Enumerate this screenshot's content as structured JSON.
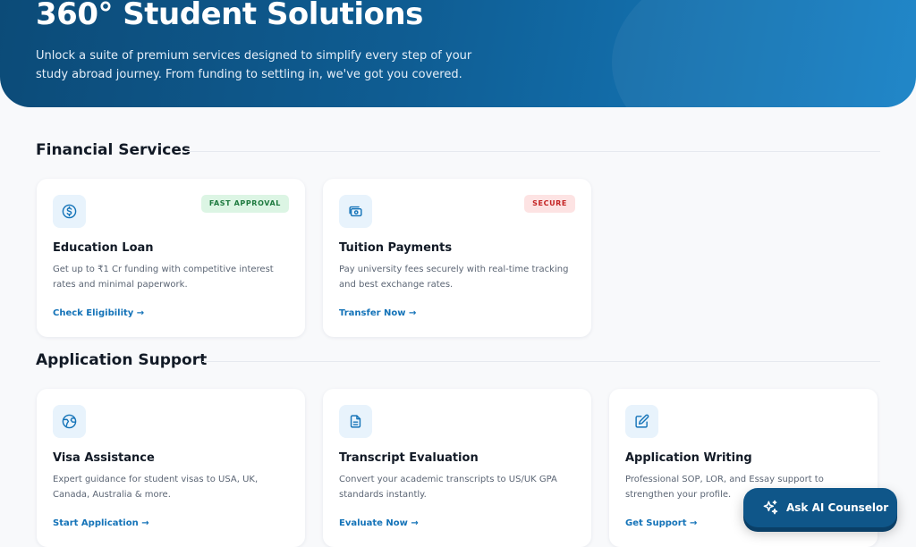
{
  "hero": {
    "title": "360° Student Solutions",
    "subtitle": "Unlock a suite of premium services designed to simplify every step of your study abroad journey. From funding to settling in, we've got you covered."
  },
  "sections": [
    {
      "title": "Financial Services",
      "cards": [
        {
          "icon": "dollar-circle-icon",
          "badge": "FAST APPROVAL",
          "title": "Education Loan",
          "description": "Get up to ₹1 Cr funding with competitive interest rates and minimal paperwork.",
          "link": "Check Eligibility →"
        },
        {
          "icon": "money-transfer-icon",
          "badge": "SECURE",
          "title": "Tuition Payments",
          "description": "Pay university fees securely with real-time tracking and best exchange rates.",
          "link": "Transfer Now →"
        }
      ]
    },
    {
      "title": "Application Support",
      "cards": [
        {
          "icon": "globe-icon",
          "title": "Visa Assistance",
          "description": "Expert guidance for student visas to USA, UK, Canada, Australia & more.",
          "link": "Start Application →"
        },
        {
          "icon": "document-icon",
          "title": "Transcript Evaluation",
          "description": "Convert your academic transcripts to US/UK GPA standards instantly.",
          "link": "Evaluate Now →"
        },
        {
          "icon": "edit-icon",
          "title": "Application Writing",
          "description": "Professional SOP, LOR, and Essay support to strengthen your profile.",
          "link": "Get Support →"
        }
      ]
    }
  ],
  "fab": {
    "icon": "sparkle-icon",
    "label": "Ask AI Counselor"
  },
  "colors": {
    "primary": "#1473b8",
    "hero_start": "#0c4b78",
    "hero_end": "#1681c6",
    "badge_green_bg": "#dcf5e4",
    "badge_green_text": "#1e7a3f",
    "badge_red_bg": "#fde3e3",
    "badge_red_text": "#c42323"
  }
}
